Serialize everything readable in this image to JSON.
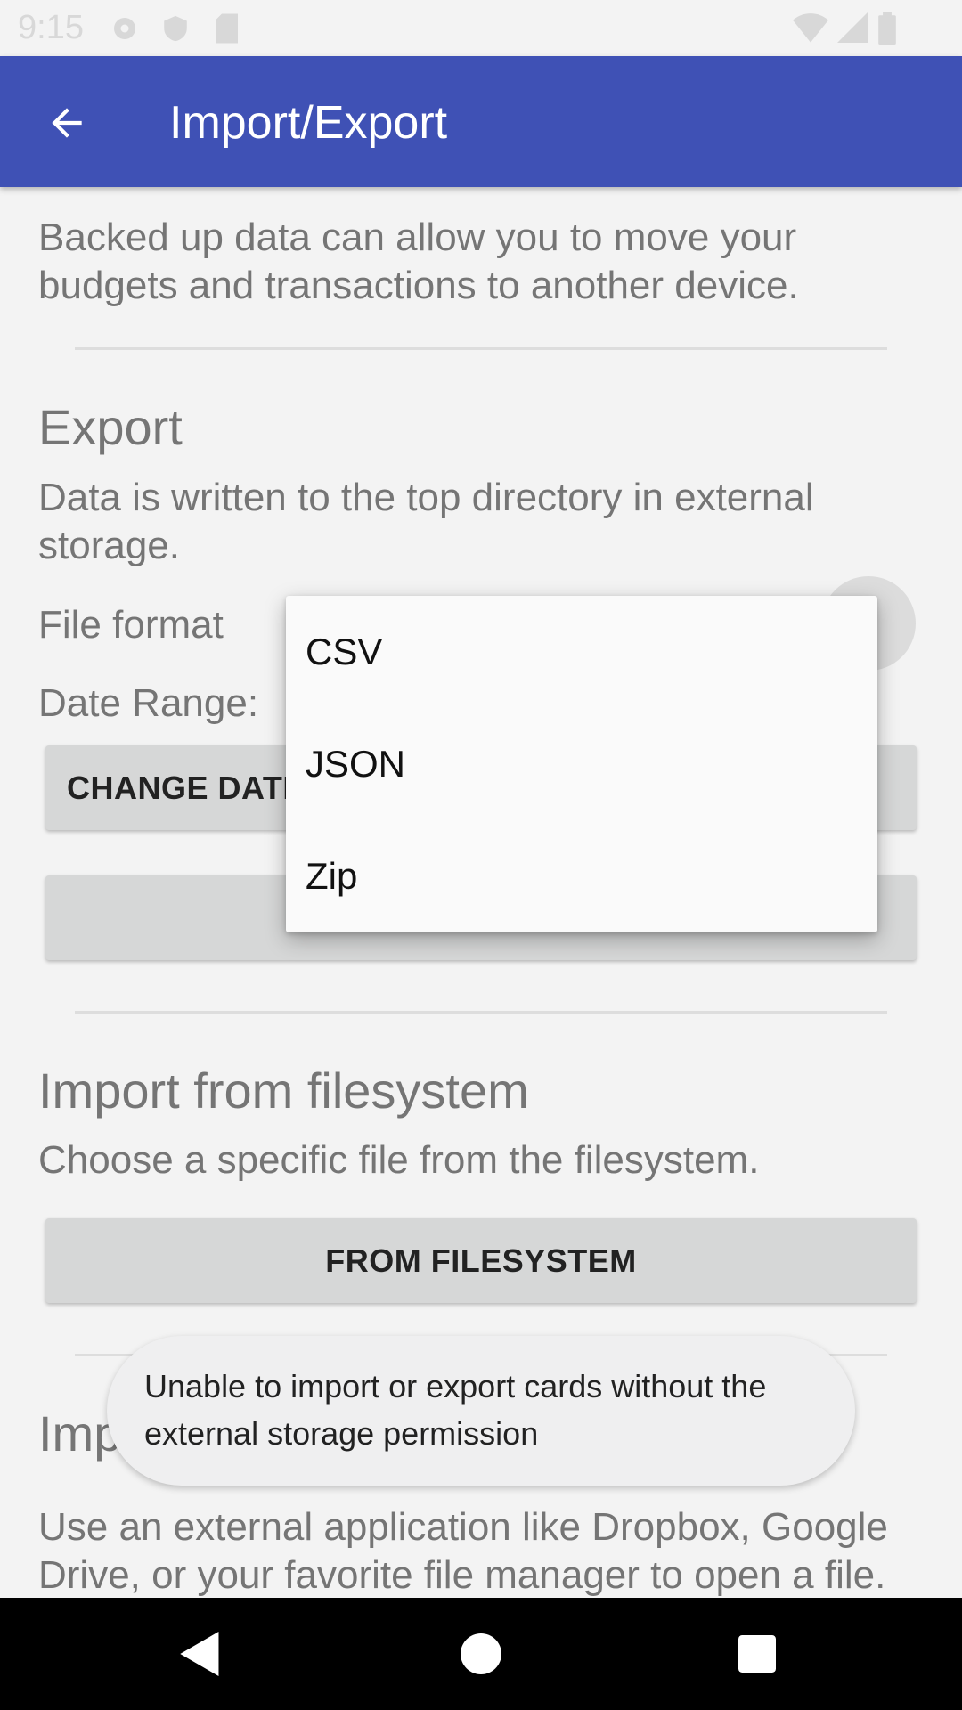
{
  "status_bar": {
    "time": "9:15"
  },
  "app_bar": {
    "title": "Import/Export",
    "back_icon": "arrow-back-icon"
  },
  "intro": {
    "text": "Backed up data can allow you to move your budgets and transactions to another device."
  },
  "export": {
    "heading": "Export",
    "description": "Data is written to the top directory in external storage.",
    "file_format_label": "File format",
    "date_range_label": "Date Range:",
    "change_date_button": "CHANGE DATE",
    "format_options": [
      "CSV",
      "JSON",
      "Zip"
    ]
  },
  "import_filesystem": {
    "heading": "Import from filesystem",
    "description": "Choose a specific file from the filesystem.",
    "button": "FROM FILESYSTEM"
  },
  "import_app": {
    "heading": "Imp",
    "description": "Use an external application like Dropbox, Google Drive, or your favorite file manager to open a file."
  },
  "toast": {
    "message": "Unable to import or export cards without the external storage permission"
  },
  "nav_bar": {
    "back_icon": "nav-back-icon",
    "home_icon": "nav-home-icon",
    "recents_icon": "nav-recents-icon"
  }
}
